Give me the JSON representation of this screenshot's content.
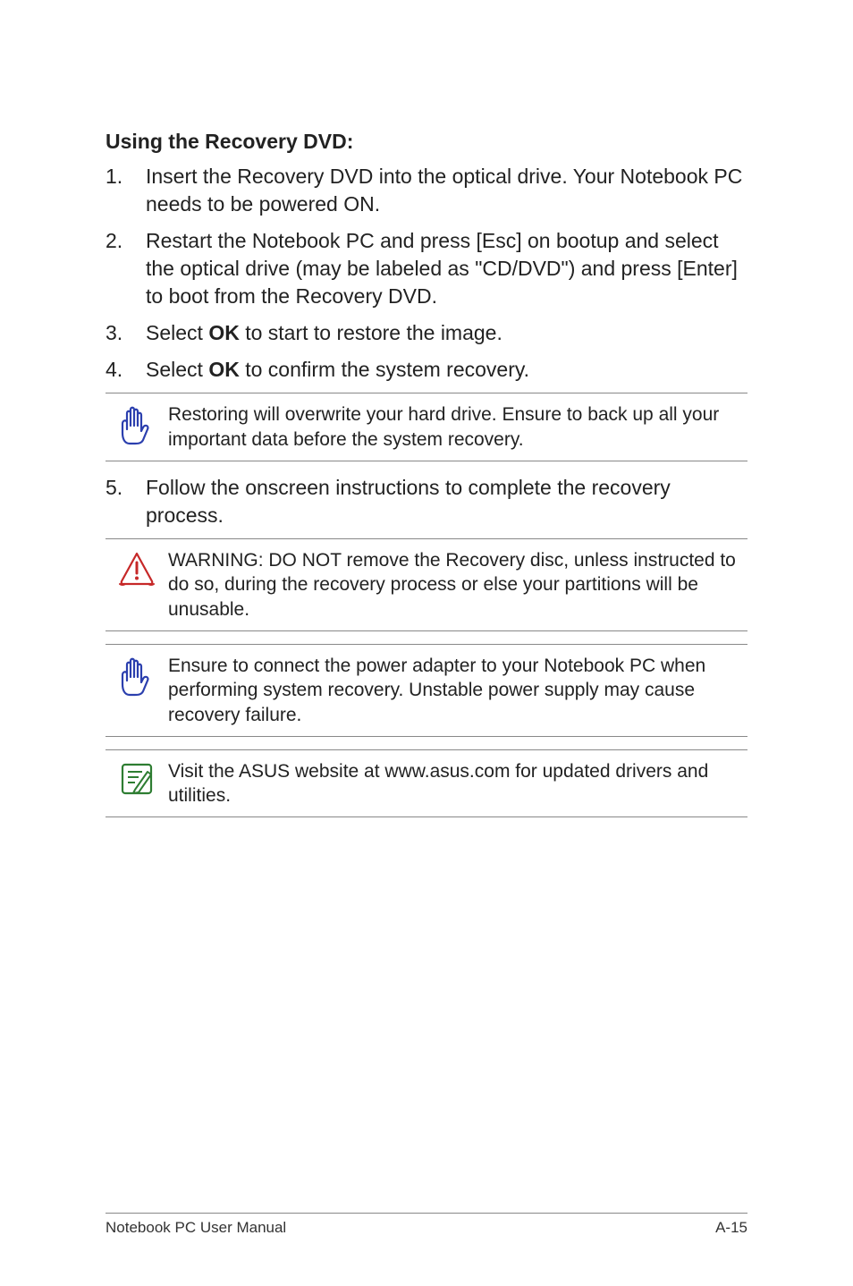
{
  "heading": "Using the Recovery DVD:",
  "steps": [
    {
      "num": "1.",
      "text": "Insert the Recovery DVD into the optical drive. Your Notebook PC needs to be powered ON."
    },
    {
      "num": "2.",
      "text": "Restart the Notebook PC and press [Esc] on bootup and select the optical drive (may be labeled as \"CD/DVD\") and press [Enter] to boot from the Recovery DVD."
    },
    {
      "num": "3.",
      "before": "Select ",
      "bold": "OK",
      "after": " to start to restore the image."
    },
    {
      "num": "4.",
      "before": "Select ",
      "bold": "OK",
      "after": " to confirm the system recovery."
    }
  ],
  "step5": {
    "num": "5.",
    "text": "Follow the onscreen instructions to complete the recovery process."
  },
  "callouts": {
    "c1": "Restoring will overwrite your hard drive. Ensure to back up all your important data before the system recovery.",
    "c2": "WARNING: DO NOT remove the Recovery disc, unless instructed to do so, during the recovery process or else your partitions will be unusable.",
    "c3": "Ensure to connect the power adapter to your Notebook PC when performing system recovery. Unstable power supply may cause recovery failure.",
    "c4": "Visit the ASUS website at www.asus.com for updated drivers and utilities."
  },
  "footer": {
    "left": "Notebook PC User Manual",
    "right": "A-15"
  }
}
